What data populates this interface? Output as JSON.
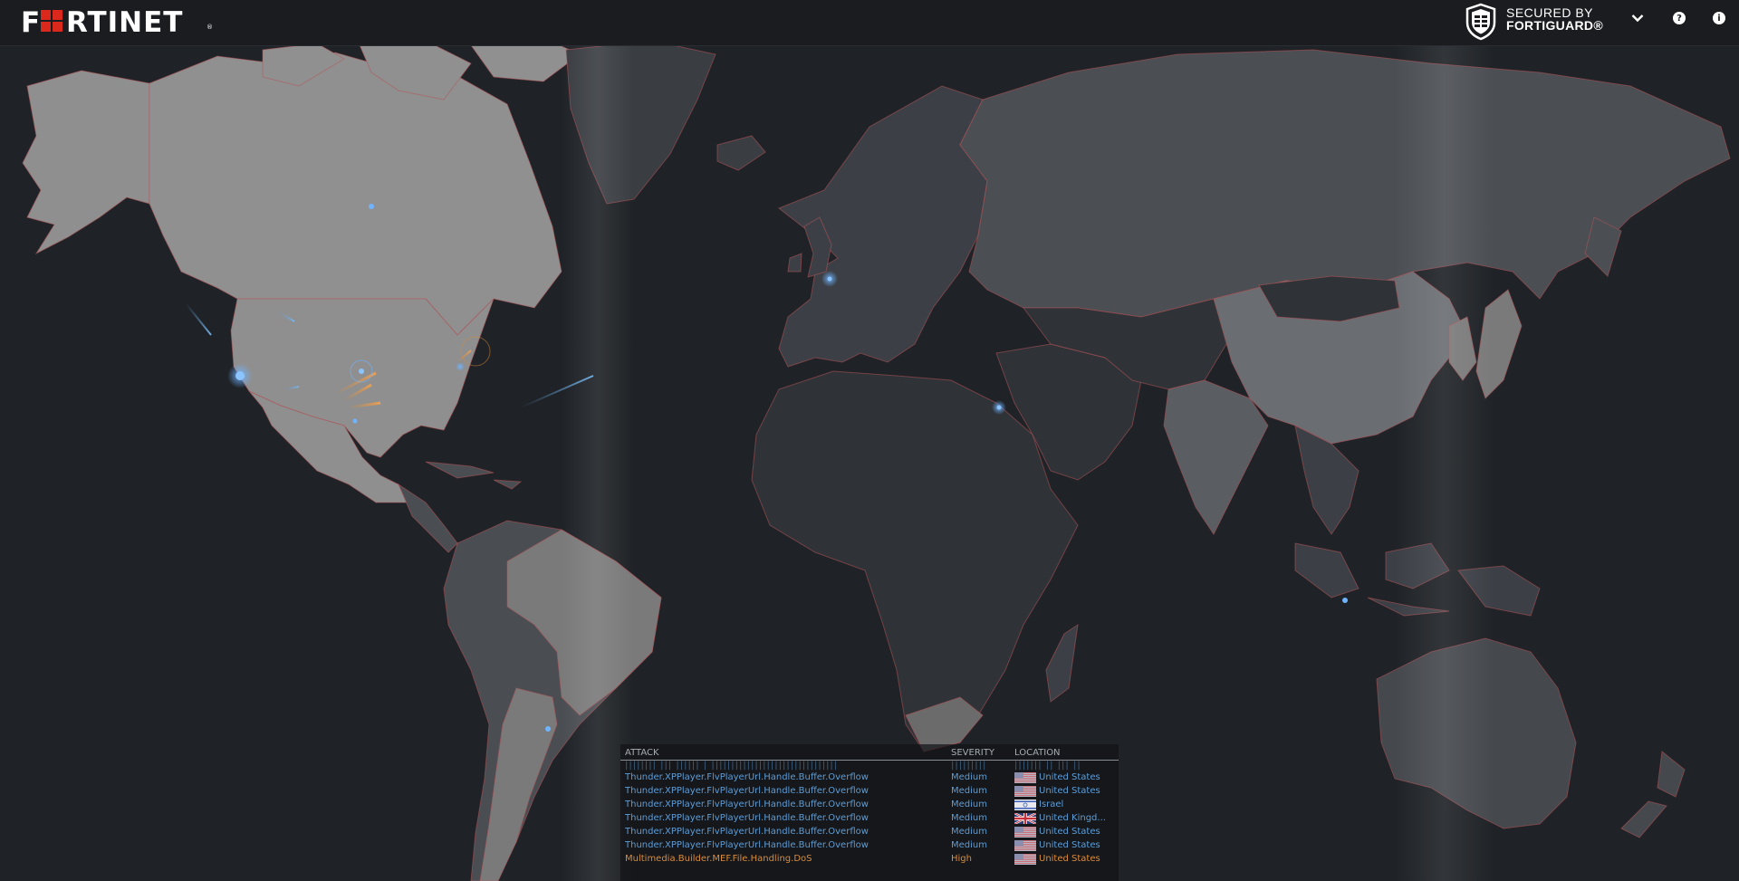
{
  "header": {
    "logo_text": "FRTINET",
    "logo_reg": "®",
    "secured_line1": "SECURED BY",
    "secured_line2": "FORTIGUARD®",
    "chevron_icon": "chevron-down-icon",
    "help_icon": "help-icon",
    "help_glyph": "?",
    "info_icon": "info-icon",
    "info_glyph": "i"
  },
  "colors": {
    "background": "#1f2226",
    "land_highlight": "#8f8f8f",
    "land_mid": "#4a4d52",
    "land_dark": "#2b2f35",
    "border_glow": "#c85a5a",
    "attack_medium": "#5d9dd6",
    "attack_high": "#d98c3c",
    "brand_red": "#da291c"
  },
  "table": {
    "headers": {
      "attack": "ATTACK",
      "severity": "SEVERITY",
      "location": "LOCATION"
    },
    "ghost_row": {
      "attack": "|||||||| ||| |||||| | ||||||||||||||||||||||||||||||||",
      "severity": "|||||||||",
      "location": "||||||| || ||| ||"
    },
    "rows": [
      {
        "attack": "Thunder.XPPlayer.FlvPlayerUrl.Handle.Buffer.Overflow",
        "severity": "Medium",
        "location": "United States",
        "flag": "us"
      },
      {
        "attack": "Thunder.XPPlayer.FlvPlayerUrl.Handle.Buffer.Overflow",
        "severity": "Medium",
        "location": "United States",
        "flag": "us"
      },
      {
        "attack": "Thunder.XPPlayer.FlvPlayerUrl.Handle.Buffer.Overflow",
        "severity": "Medium",
        "location": "Israel",
        "flag": "il"
      },
      {
        "attack": "Thunder.XPPlayer.FlvPlayerUrl.Handle.Buffer.Overflow",
        "severity": "Medium",
        "location": "United Kingd...",
        "flag": "gb"
      },
      {
        "attack": "Thunder.XPPlayer.FlvPlayerUrl.Handle.Buffer.Overflow",
        "severity": "Medium",
        "location": "United States",
        "flag": "us"
      },
      {
        "attack": "Thunder.XPPlayer.FlvPlayerUrl.Handle.Buffer.Overflow",
        "severity": "Medium",
        "location": "United States",
        "flag": "us"
      },
      {
        "attack": "Multimedia.Builder.MEF.File.Handling.DoS",
        "severity": "High",
        "location": "United States",
        "flag": "us"
      }
    ]
  }
}
